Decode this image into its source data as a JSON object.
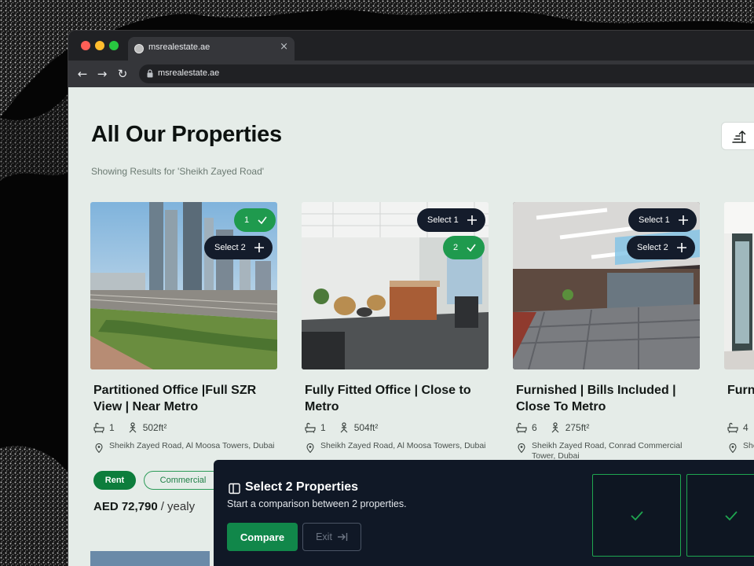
{
  "browser": {
    "tab_title": "msrealestate.ae",
    "tab_close": "×",
    "url": "msrealestate.ae",
    "nav": {
      "back": "←",
      "forward": "→",
      "reload": "↻"
    }
  },
  "page": {
    "title": "All Our Properties",
    "results_text": "Showing Results for 'Sheikh Zayed Road'"
  },
  "cards": [
    {
      "title": "Partitioned Office |Full SZR View | Near Metro",
      "baths": "1",
      "area": "502ft²",
      "address": "Sheikh Zayed Road, Al Moosa Towers, Dubai",
      "tags": [
        "Rent",
        "Commercial"
      ],
      "price": "AED 72,790",
      "price_suffix": "/ yealy",
      "badge_selected": "1",
      "badge_select": "Select 2"
    },
    {
      "title": "Fully Fitted Office | Close to Metro",
      "baths": "1",
      "area": "504ft²",
      "address": "Sheikh Zayed Road, Al Moosa Towers, Dubai",
      "badge_select": "Select 1",
      "badge_selected": "2"
    },
    {
      "title": "Furnished | Bills Included | Close To Metro",
      "baths": "6",
      "area": "275ft²",
      "address": "Sheikh Zayed Road, Conrad Commercial Tower, Dubai",
      "badge_select_1": "Select 1",
      "badge_select_2": "Select 2"
    },
    {
      "title": "Furn Clos",
      "baths": "4",
      "address": "She Ho"
    }
  ],
  "compare": {
    "title": "Select 2 Properties",
    "subtitle": "Start a comparison between 2 properties.",
    "compare_label": "Compare",
    "exit_label": "Exit"
  },
  "colors": {
    "page_bg": "#e5ece8",
    "accent_green": "#11874a",
    "badge_green": "#1f9a4e",
    "dark_pill": "#141c2b",
    "panel_bg": "#101826"
  }
}
